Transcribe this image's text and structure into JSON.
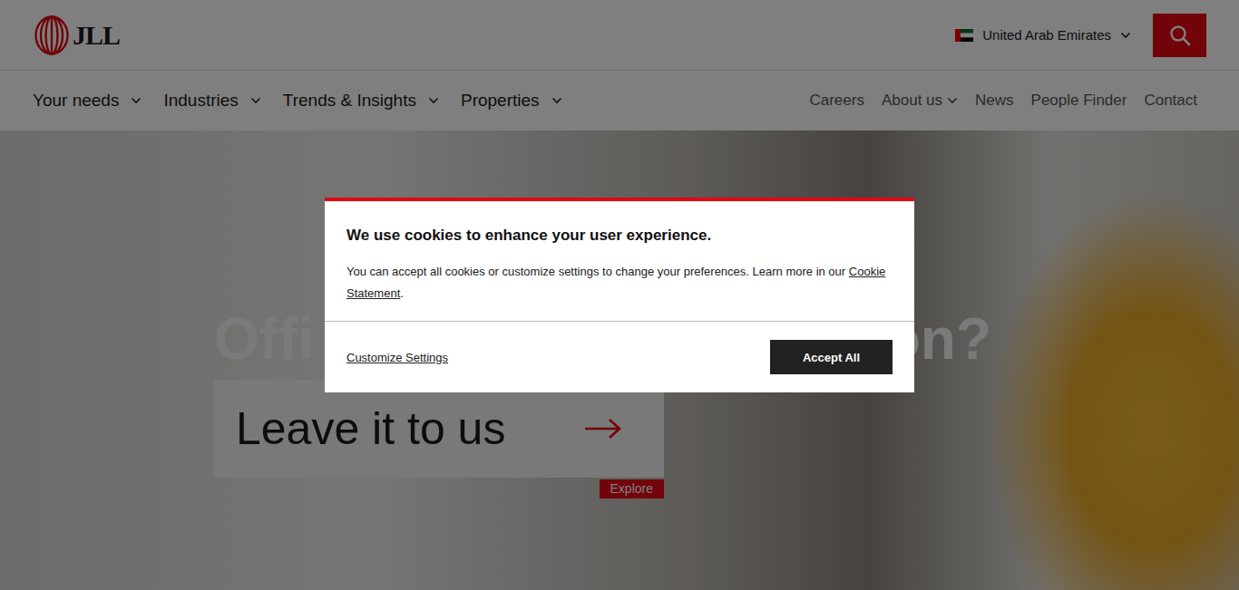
{
  "logo": {
    "text": "JLL"
  },
  "country": {
    "label": "United Arab Emirates"
  },
  "nav": {
    "primary": [
      {
        "label": "Your needs",
        "has_menu": true
      },
      {
        "label": "Industries",
        "has_menu": true
      },
      {
        "label": "Trends & Insights",
        "has_menu": true
      },
      {
        "label": "Properties",
        "has_menu": true
      }
    ],
    "secondary": [
      {
        "label": "Careers",
        "has_menu": false
      },
      {
        "label": "About us",
        "has_menu": true
      },
      {
        "label": "News",
        "has_menu": false
      },
      {
        "label": "People Finder",
        "has_menu": false
      },
      {
        "label": "Contact",
        "has_menu": false
      }
    ]
  },
  "hero": {
    "headline_start": "Offi",
    "headline_end": "on?",
    "cta": "Leave it to us",
    "tag": "Explore"
  },
  "cookie_dialog": {
    "title": "We use cookies to enhance your user experience.",
    "text": "You can accept all cookies or customize settings to change your preferences. Learn more in our ",
    "link": "Cookie Statement",
    "after_link": ".",
    "customize": "Customize Settings",
    "accept": "Accept All"
  }
}
